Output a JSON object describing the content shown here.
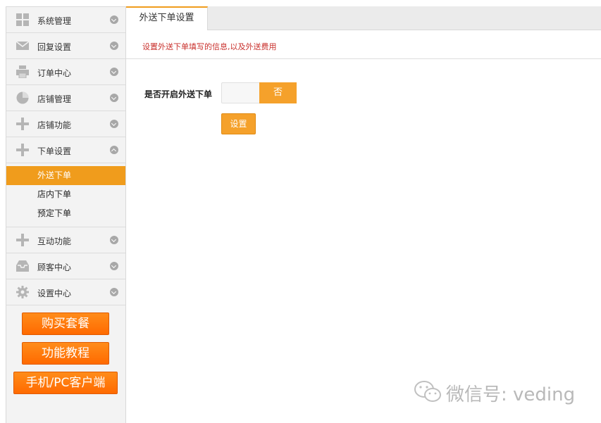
{
  "sidebar": {
    "menu": [
      {
        "label": "系统管理",
        "icon": "grid-icon"
      },
      {
        "label": "回复设置",
        "icon": "envelope-icon"
      },
      {
        "label": "订单中心",
        "icon": "printer-icon"
      },
      {
        "label": "店铺管理",
        "icon": "pie-chart-icon"
      },
      {
        "label": "店铺功能",
        "icon": "plus-icon"
      },
      {
        "label": "下单设置",
        "icon": "plus-icon"
      }
    ],
    "submenu": [
      {
        "label": "外送下单",
        "active": true
      },
      {
        "label": "店内下单"
      },
      {
        "label": "预定下单"
      }
    ],
    "menu2": [
      {
        "label": "互动功能",
        "icon": "plus-icon"
      },
      {
        "label": "顾客中心",
        "icon": "inbox-icon"
      },
      {
        "label": "设置中心",
        "icon": "gear-icon"
      }
    ],
    "buttons": {
      "buy": "购买套餐",
      "tutorial": "功能教程",
      "client": "手机/PC客户端"
    }
  },
  "main": {
    "tab": "外送下单设置",
    "description": "设置外送下单填写的信息,以及外送费用",
    "field_label": "是否开启外送下单",
    "toggle_value": "否",
    "set_button": "设置"
  },
  "watermark": "微信号: veding",
  "colors": {
    "accent": "#f09c1c",
    "promo": "#ff7a10",
    "desc": "#c9302c"
  }
}
